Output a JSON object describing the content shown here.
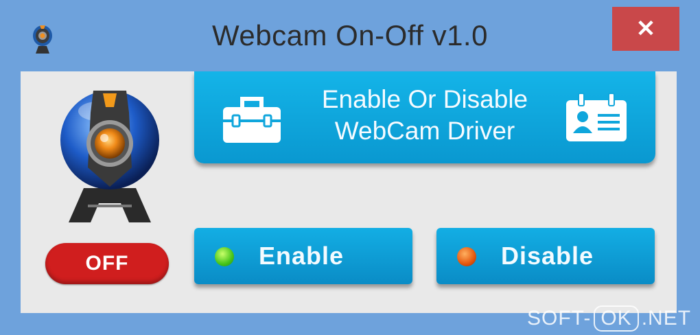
{
  "window": {
    "title": "Webcam On-Off v1.0",
    "close_glyph": "✕"
  },
  "icons": {
    "app": "webcam-app-icon",
    "webcam": "webcam-icon",
    "toolbox": "toolbox-icon",
    "id_card": "id-card-icon",
    "close": "close-icon"
  },
  "status": {
    "label": "OFF",
    "color": "#d01e1e"
  },
  "main_button": {
    "line1": "Enable Or Disable",
    "line2": "WebCam Driver"
  },
  "enable_button": {
    "label": "Enable",
    "indicator_color": "#46c41a"
  },
  "disable_button": {
    "label": "Disable",
    "indicator_color": "#e4560c"
  },
  "watermark": {
    "left": "SOFT-",
    "middle": "OK",
    "right": ".NET"
  },
  "colors": {
    "accent": "#0fa6dc",
    "close_red": "#c9484a",
    "frame_blue": "#6ea2dc",
    "client_bg": "#e9e9e9"
  }
}
